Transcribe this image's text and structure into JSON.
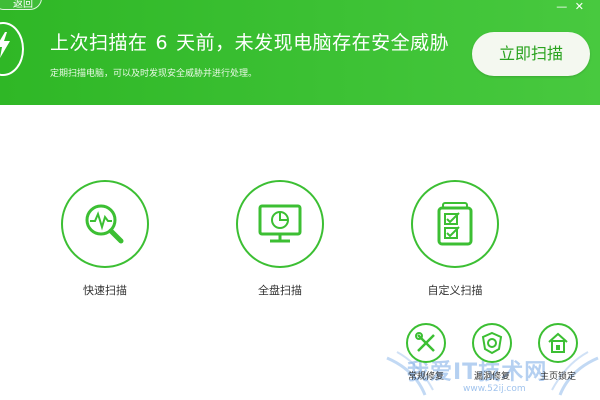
{
  "header": {
    "back_label": "返回",
    "window_controls": "—  ✕",
    "title_prefix": "上次扫描在",
    "days": "6",
    "title_suffix": "天前，未发现电脑存在安全威胁",
    "subtitle": "定期扫描电脑，可以及时发现安全威胁并进行处理。",
    "scan_now_label": "立即扫描"
  },
  "scan_options": [
    {
      "label": "快速扫描",
      "icon": "magnifier-pulse-icon"
    },
    {
      "label": "全盘扫描",
      "icon": "monitor-chart-icon"
    },
    {
      "label": "自定义扫描",
      "icon": "checklist-icon"
    }
  ],
  "tools": [
    {
      "label": "常规修复",
      "icon": "wrench-screwdriver-icon"
    },
    {
      "label": "漏洞修复",
      "icon": "shield-patch-icon"
    },
    {
      "label": "主页锁定",
      "icon": "house-lock-icon"
    }
  ],
  "watermark": {
    "text": "我爱IT技术网",
    "url": "www.52ij.com"
  },
  "colors": {
    "brand_green": "#3cbf33",
    "button_text": "#2aa31f"
  }
}
